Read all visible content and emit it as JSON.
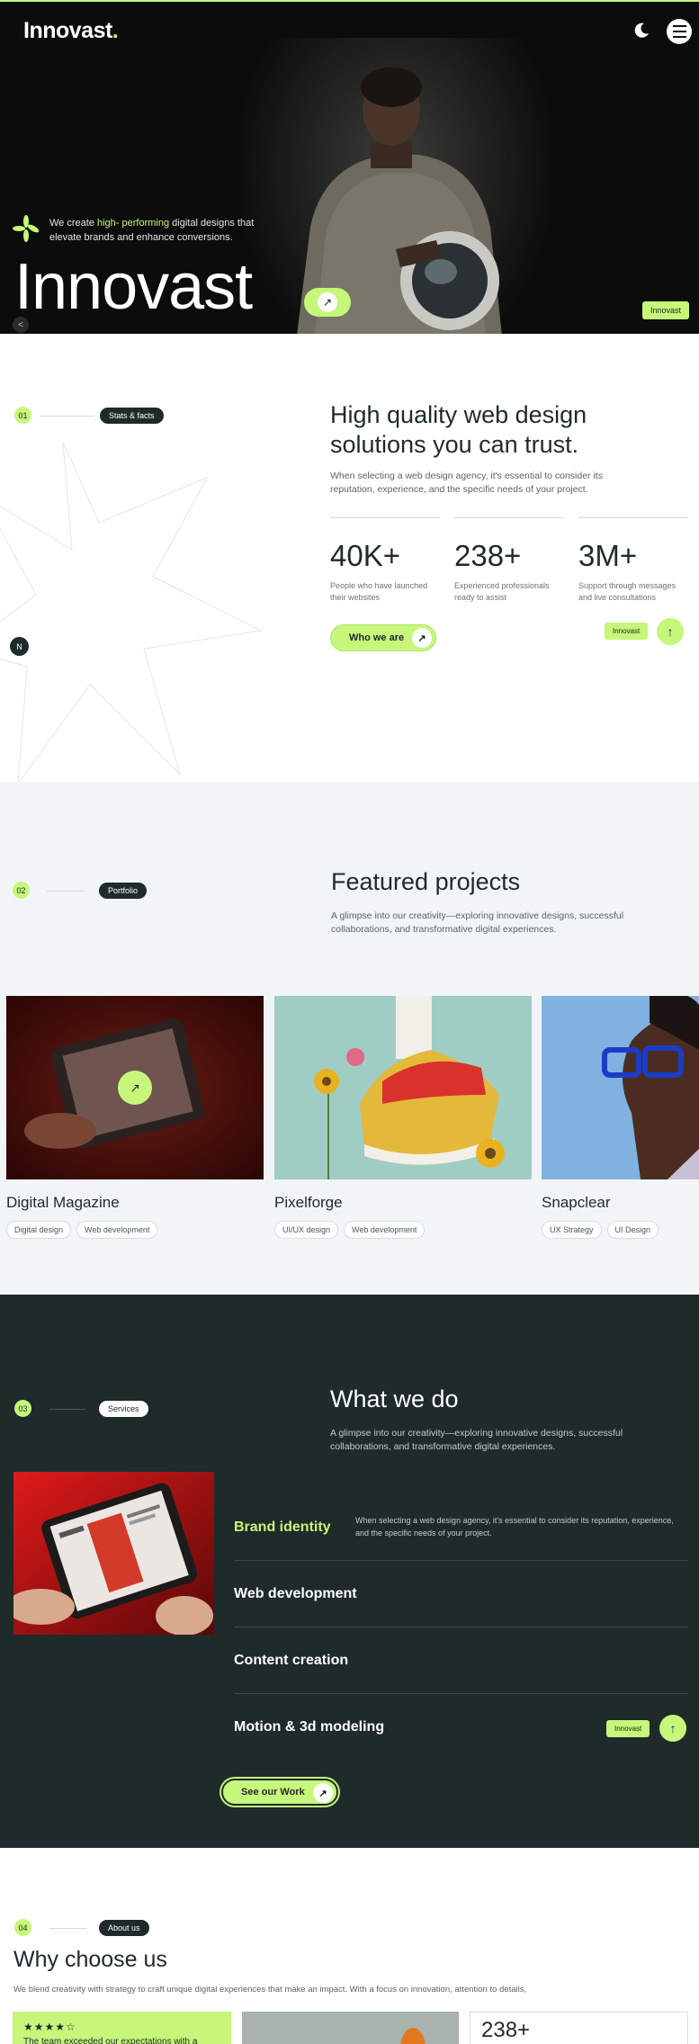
{
  "hero": {
    "logo": "Innovast",
    "logo_dot": ".",
    "tagline_pre": "We create ",
    "tagline_highlight": "high- performing",
    "tagline_post": " digital designs that elevate brands and enhance conversions.",
    "title": "Innovast",
    "badge": "Innovast",
    "back_glyph": "<"
  },
  "stats": {
    "num": "01",
    "pill": "Stats & facts",
    "heading": "High quality web design solutions you can trust.",
    "sub": "When selecting a web design agency, it's essential to consider its reputation, experience, and the specific needs of your project.",
    "items": [
      {
        "value": "40K+",
        "desc": "People who have launched their websites"
      },
      {
        "value": "238+",
        "desc": "Experienced professionals ready to assist"
      },
      {
        "value": "3M+",
        "desc": "Support through messages and live consultations"
      }
    ],
    "cta": "Who we are",
    "badge": "Innovast",
    "n_badge": "N"
  },
  "portfolio": {
    "num": "02",
    "pill": "Portfolio",
    "heading": "Featured projects",
    "sub": "A glimpse into our creativity—exploring innovative designs, successful collaborations, and transformative digital experiences.",
    "cards": [
      {
        "title": "Digital Magazine",
        "tags": [
          "Digital design",
          "Web development"
        ]
      },
      {
        "title": "Pixelforge",
        "tags": [
          "UI/UX design",
          "Web development"
        ]
      },
      {
        "title": "Snapclear",
        "tags": [
          "UX Strategy",
          "UI Design"
        ]
      }
    ]
  },
  "services": {
    "num": "03",
    "pill": "Services",
    "heading": "What we do",
    "sub": "A glimpse into our creativity—exploring innovative designs, successful collaborations, and transformative digital experiences.",
    "items": [
      {
        "name": "Brand identity",
        "desc": "When selecting a web design agency, it's essential to consider its reputation, experience, and the specific needs of your project."
      },
      {
        "name": "Web development",
        "desc": ""
      },
      {
        "name": "Content creation",
        "desc": ""
      },
      {
        "name": "Motion & 3d modeling",
        "desc": ""
      }
    ],
    "cta": "See our Work",
    "badge": "Innovast"
  },
  "about": {
    "num": "04",
    "pill": "About us",
    "heading": "Why choose us",
    "sub": "We blend creativity with strategy to craft unique digital experiences that make an impact. With a focus on innovation, attention to details,",
    "stars": "★★★★☆",
    "review": "The team exceeded our expectations with a",
    "count": "238+"
  },
  "colors": {
    "accent": "#c6f77a",
    "dark": "#1f2a2b",
    "light_bg": "#f2f5f8"
  },
  "icons": {
    "moon": "moon-icon",
    "menu": "menu-icon",
    "arrow": "arrow-up-right-icon",
    "up": "arrow-up-icon",
    "spark": "spark-icon"
  }
}
